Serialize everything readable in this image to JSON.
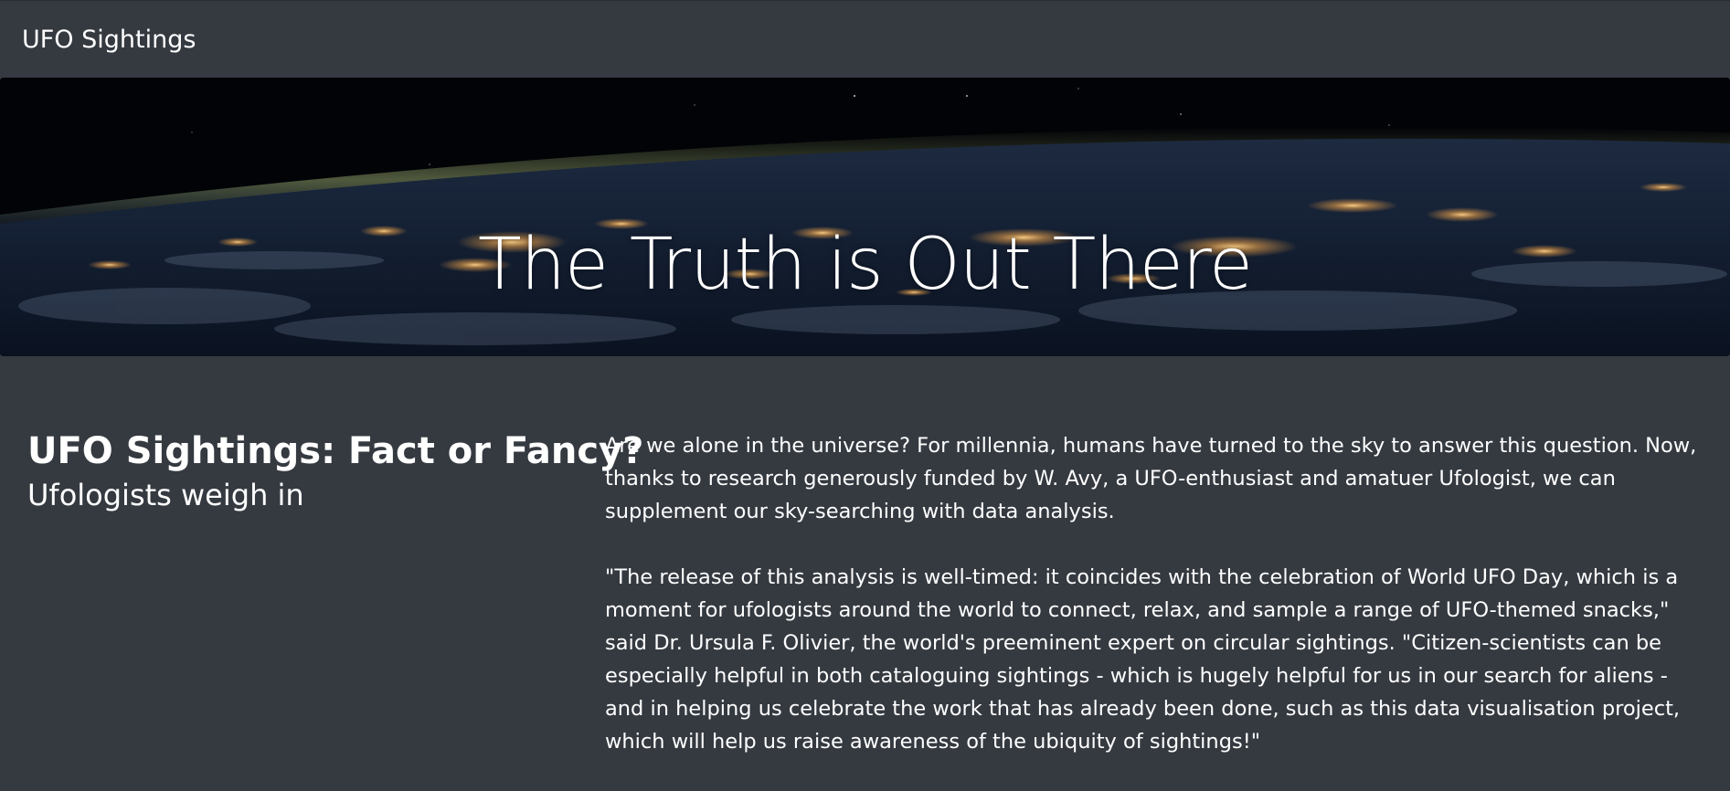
{
  "navbar": {
    "brand": "UFO Sightings"
  },
  "hero": {
    "title": "The Truth is Out There"
  },
  "article": {
    "title": "UFO Sightings: Fact or Fancy?",
    "subtitle": "Ufologists weigh in",
    "paragraphs": [
      "Are we alone in the universe? For millennia, humans have turned to the sky to answer this question. Now, thanks to research generously funded by W. Avy, a UFO-enthusiast and amatuer Ufologist, we can supplement our sky-searching with data analysis.",
      "\"The release of this analysis is well-timed: it coincides with the celebration of World UFO Day, which is a moment for ufologists around the world to connect, relax, and sample a range of UFO-themed snacks,\" said Dr. Ursula F. Olivier, the world's preeminent expert on circular sightings. \"Citizen-scientists can be especially helpful in both cataloguing sightings - which is hugely helpful for us in our search for aliens - and in helping us celebrate the work that has already been done, such as this data visualisation project, which will help us raise awareness of the ubiquity of sightings!\""
    ]
  },
  "colors": {
    "page_background": "#353a41",
    "text": "#ffffff",
    "hero_space": "#03050a"
  }
}
